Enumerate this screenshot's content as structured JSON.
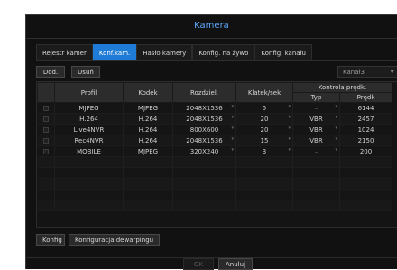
{
  "window": {
    "title": "Kamera"
  },
  "tabs": [
    {
      "label": "Rejestr kamer",
      "active": false
    },
    {
      "label": "Konf.kam.",
      "active": true
    },
    {
      "label": "Hasło kamery",
      "active": false
    },
    {
      "label": "Konfig. na żywo",
      "active": false
    },
    {
      "label": "Konfig. kanału",
      "active": false
    }
  ],
  "toolbar": {
    "add_label": "Dod.",
    "delete_label": "Usuń"
  },
  "channel_select": {
    "value": "Kanał3"
  },
  "table": {
    "headers": {
      "profile": "Profil",
      "codec": "Kodek",
      "resolution": "Rozdziel.",
      "fps": "Klatek/sek",
      "bitrate_control": "Kontrola prędk.",
      "type": "Typ",
      "speed": "Prędk"
    },
    "rows": [
      {
        "profile": "MJPEG",
        "codec": "MJPEG",
        "resolution": "2048X1536",
        "fps": "5",
        "type": "–",
        "speed": "6144"
      },
      {
        "profile": "H.264",
        "codec": "H.264",
        "resolution": "2048X1536",
        "fps": "20",
        "type": "VBR",
        "speed": "2457"
      },
      {
        "profile": "Live4NVR",
        "codec": "H.264",
        "resolution": "800X600",
        "fps": "20",
        "type": "VBR",
        "speed": "1024"
      },
      {
        "profile": "Rec4NVR",
        "codec": "H.264",
        "resolution": "2048X1536",
        "fps": "15",
        "type": "VBR",
        "speed": "2150"
      },
      {
        "profile": "MOBILE",
        "codec": "MJPEG",
        "resolution": "320X240",
        "fps": "3",
        "type": "–",
        "speed": "200"
      }
    ]
  },
  "bottom": {
    "config_label": "Konfig",
    "dewarping_label": "Konfiguracja dewarpingu"
  },
  "dialog": {
    "ok_label": "OK",
    "cancel_label": "Anuluj"
  },
  "colors": {
    "accent": "#1f7cd6",
    "title": "#5aaaff"
  }
}
